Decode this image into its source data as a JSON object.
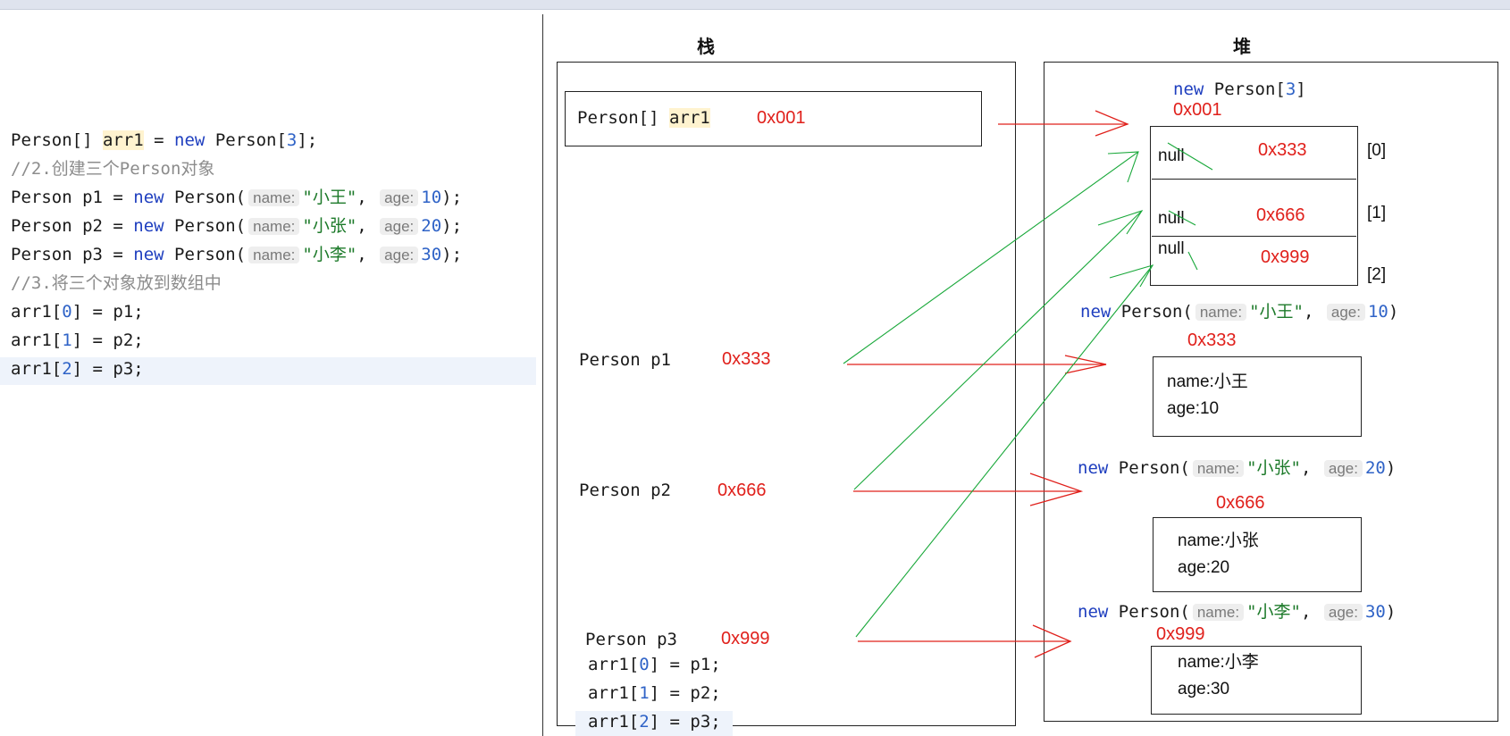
{
  "code": {
    "line1": {
      "type": "Person[] ",
      "var": "arr1",
      "eq": " = ",
      "new": "new",
      "ctor": " Person[",
      "num": "3",
      "end": "];"
    },
    "comment2": "//2.创建三个Person对象",
    "persons": [
      {
        "decl": "Person p1 = ",
        "new": "new",
        "ctor": " Person(",
        "hint_name": "name:",
        "str": "\"小王\"",
        "sep": ",",
        "hint_age": "age:",
        "num": "10",
        "end": ");"
      },
      {
        "decl": "Person p2 = ",
        "new": "new",
        "ctor": " Person(",
        "hint_name": "name:",
        "str": "\"小张\"",
        "sep": ",",
        "hint_age": "age:",
        "num": "20",
        "end": ");"
      },
      {
        "decl": "Person p3 = ",
        "new": "new",
        "ctor": " Person(",
        "hint_name": "name:",
        "str": "\"小李\"",
        "sep": ",",
        "hint_age": "age:",
        "num": "30",
        "end": ");"
      }
    ],
    "comment3": "//3.将三个对象放到数组中",
    "assign": [
      {
        "pre": "arr1[",
        "idx": "0",
        "post": "] = p1;"
      },
      {
        "pre": "arr1[",
        "idx": "1",
        "post": "] = p2;"
      },
      {
        "pre": "arr1[",
        "idx": "2",
        "post": "] = p3;"
      }
    ]
  },
  "stack": {
    "title": "栈",
    "arr_type": "Person[] ",
    "arr_var": "arr1",
    "arr_addr": "0x001",
    "p1": {
      "label": "Person p1",
      "addr": "0x333"
    },
    "p2": {
      "label": "Person p2",
      "addr": "0x666"
    },
    "p3": {
      "label": "Person p3",
      "addr": "0x999"
    },
    "assign": [
      {
        "pre": "arr1[",
        "idx": "0",
        "post": "] = p1;"
      },
      {
        "pre": "arr1[",
        "idx": "1",
        "post": "] = p2;"
      },
      {
        "pre": "arr1[",
        "idx": "2",
        "post": "] = p3;"
      }
    ]
  },
  "heap": {
    "title": "堆",
    "array": {
      "new": "new",
      "ctor": " Person[",
      "num": "3",
      "end": "]",
      "addr": "0x001",
      "cells": [
        {
          "null": "null",
          "addr": "0x333",
          "index": "[0]"
        },
        {
          "null": "null",
          "addr": "0x666",
          "index": "[1]"
        },
        {
          "null": "null",
          "addr": "0x999",
          "index": "[2]"
        }
      ]
    },
    "objects": [
      {
        "new": "new",
        "ctor": " Person(",
        "hint_name": "name:",
        "str": "\"小王\"",
        "sep": ",",
        "hint_age": "age:",
        "num": "10",
        "end": ")",
        "addr": "0x333",
        "name": "name:小王",
        "age": "age:10"
      },
      {
        "new": "new",
        "ctor": " Person(",
        "hint_name": "name:",
        "str": "\"小张\"",
        "sep": ",",
        "hint_age": "age:",
        "num": "20",
        "end": ")",
        "addr": "0x666",
        "name": "name:小张",
        "age": "age:20"
      },
      {
        "new": "new",
        "ctor": " Person(",
        "hint_name": "name:",
        "str": "\"小李\"",
        "sep": ",",
        "hint_age": "age:",
        "num": "30",
        "end": ")",
        "addr": "0x999",
        "name": "name:小李",
        "age": "age:30"
      }
    ]
  },
  "colors": {
    "pointer_arrow": "#e0201b",
    "reference_arrow": "#19a83a"
  }
}
